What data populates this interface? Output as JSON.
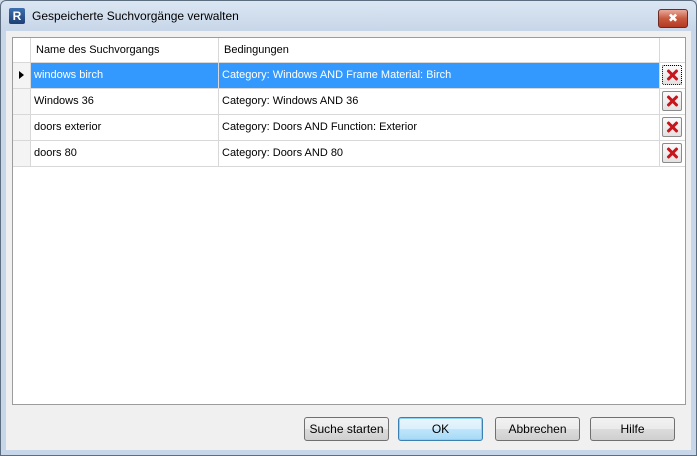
{
  "window": {
    "title": "Gespeicherte Suchvorgänge verwalten",
    "close_glyph": "✖"
  },
  "grid": {
    "columns": [
      "Name des Suchvorgangs",
      "Bedingungen"
    ],
    "rows": [
      {
        "name": "windows birch",
        "conditions": "Category: Windows AND Frame Material: Birch",
        "selected": true
      },
      {
        "name": "Windows 36",
        "conditions": "Category: Windows AND 36",
        "selected": false
      },
      {
        "name": "doors exterior",
        "conditions": "Category: Doors AND Function: Exterior",
        "selected": false
      },
      {
        "name": "doors 80",
        "conditions": "Category: Doors AND 80",
        "selected": false
      }
    ]
  },
  "buttons": {
    "start_search": "Suche starten",
    "ok": "OK",
    "cancel": "Abbrechen",
    "help": "Hilfe"
  },
  "icons": {
    "app": "revit-logo-icon",
    "delete": "delete-x-icon"
  },
  "colors": {
    "selection": "#3399ff",
    "delete_red": "#c8161d"
  }
}
